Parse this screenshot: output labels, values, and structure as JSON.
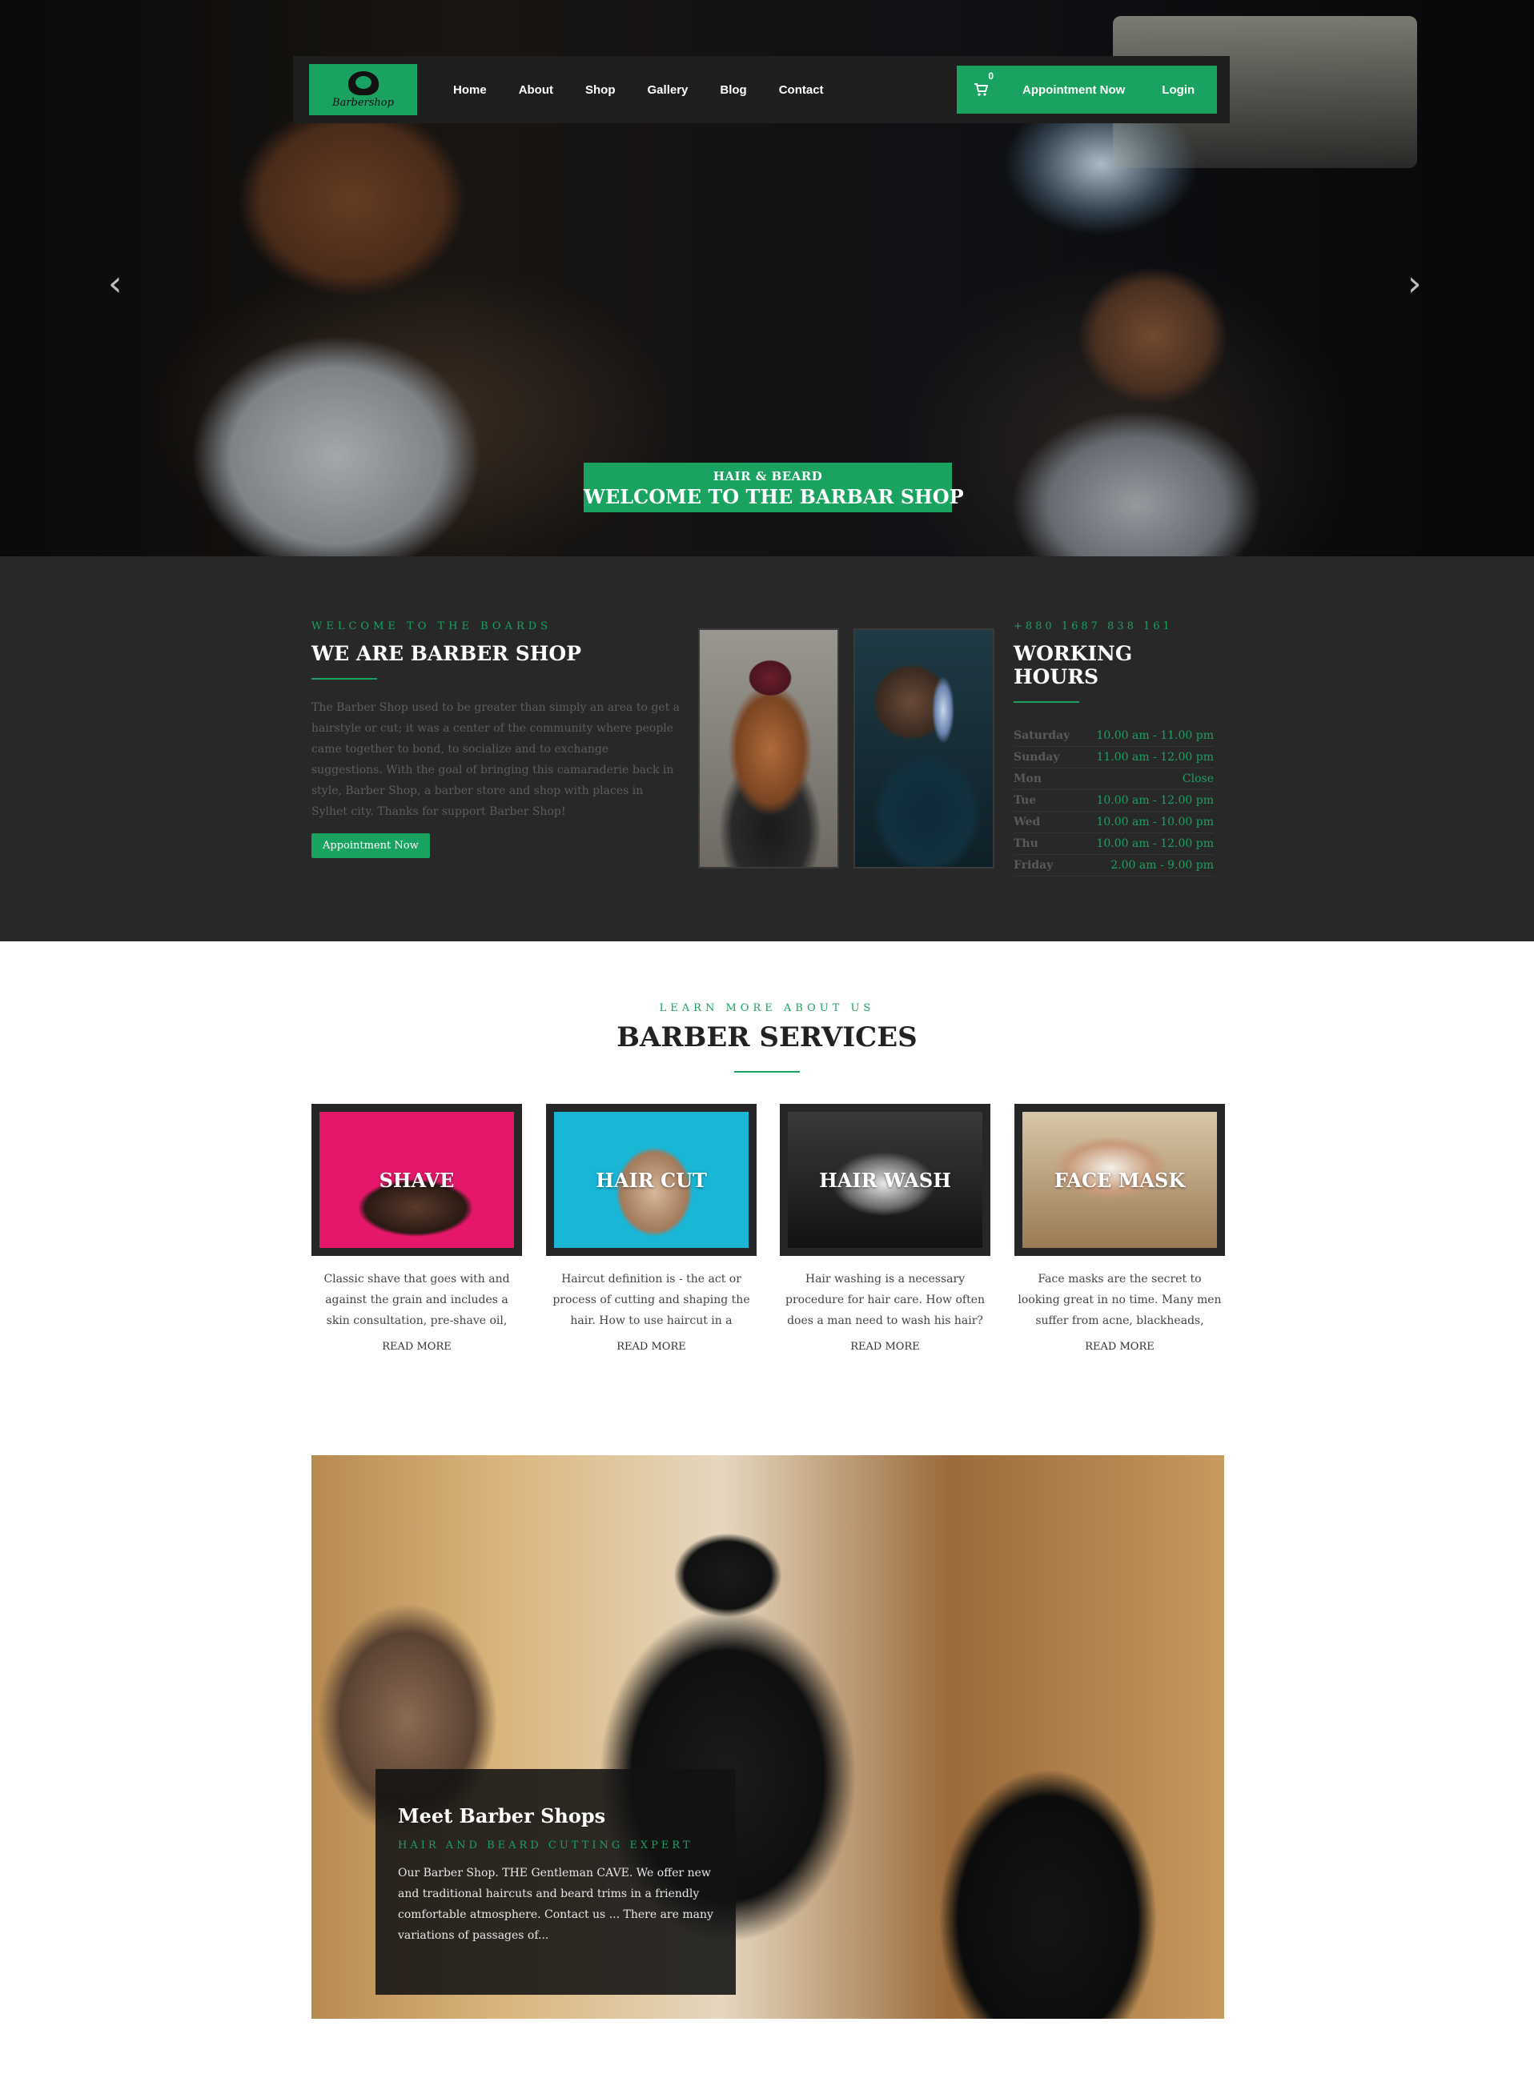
{
  "navbar": {
    "logo_text": "Barbershop",
    "links": [
      "Home",
      "About",
      "Shop",
      "Gallery",
      "Blog",
      "Contact"
    ],
    "cart_count": "0",
    "cart_icon": "cart-icon",
    "appointment_label": "Appointment Now",
    "login_label": "Login"
  },
  "hero": {
    "subtitle": "HAIR & BEARD",
    "title": "WELCOME TO THE BARBAR SHOP",
    "prev_icon": "chevron-left-icon",
    "next_icon": "chevron-right-icon"
  },
  "about": {
    "kicker": "WELCOME TO THE BOARDS",
    "title": "WE ARE BARBER SHOP",
    "body": "The Barber Shop used to be greater than simply an area to get a hairstyle or cut; it was a center of the community where people came together to bond, to socialize and to exchange suggestions. With the goal of bringing this camaraderie back in style, Barber Shop, a barber store and shop with places in Sylhet city. Thanks for support Barber Shop!",
    "button": "Appointment Now"
  },
  "hours": {
    "phone": "+880 1687 838 161",
    "title": "WORKING HOURS",
    "rows": [
      {
        "day": "Saturday",
        "time": "10.00 am - 11.00 pm"
      },
      {
        "day": "Sunday",
        "time": "11.00 am - 12.00 pm"
      },
      {
        "day": "Mon",
        "time": "Close"
      },
      {
        "day": "Tue",
        "time": "10.00 am - 12.00 pm"
      },
      {
        "day": "Wed",
        "time": "10.00 am - 10.00 pm"
      },
      {
        "day": "Thu",
        "time": "10.00 am - 12.00 pm"
      },
      {
        "day": "Friday",
        "time": "2.00 am - 9.00 pm"
      }
    ]
  },
  "services": {
    "kicker": "LEARN MORE ABOUT US",
    "title": "BARBER SERVICES",
    "cards": [
      {
        "label": "SHAVE",
        "desc": "Classic shave that goes with and against the grain and includes a skin consultation, pre-shave oil,",
        "more": "READ MORE"
      },
      {
        "label": "HAIR CUT",
        "desc": "Haircut definition is - the act or process of cutting and shaping the hair. How to use haircut in a",
        "more": "READ MORE"
      },
      {
        "label": "HAIR WASH",
        "desc": "Hair washing is a necessary procedure for hair care. How often does a man need to wash his hair?",
        "more": "READ MORE"
      },
      {
        "label": "FACE MASK",
        "desc": "Face masks are the secret to looking great in no time. Many men suffer from acne, blackheads,",
        "more": "READ MORE"
      }
    ]
  },
  "meet": {
    "title": "Meet Barber Shops",
    "kicker": "HAIR AND BEARD CUTTING EXPERT",
    "body": "Our Barber Shop. THE Gentleman CAVE. We offer new and traditional haircuts and beard trims in a friendly comfortable atmosphere. Contact us ... There are many variations of passages of..."
  },
  "colors": {
    "accent": "#1aa260",
    "dark_section": "#282828",
    "nav_bg": "#1e1e1c"
  }
}
